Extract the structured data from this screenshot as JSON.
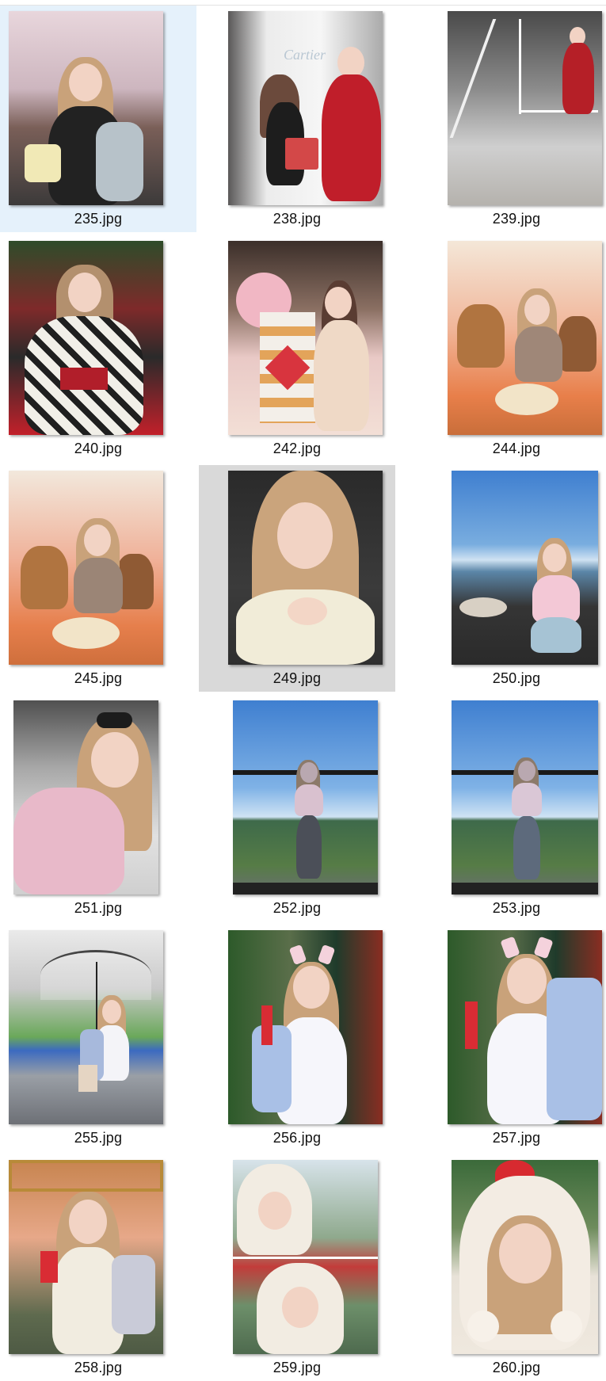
{
  "files": [
    {
      "name": "235.jpg",
      "state": "selected"
    },
    {
      "name": "238.jpg",
      "state": "normal"
    },
    {
      "name": "239.jpg",
      "state": "normal"
    },
    {
      "name": "240.jpg",
      "state": "normal"
    },
    {
      "name": "242.jpg",
      "state": "normal"
    },
    {
      "name": "244.jpg",
      "state": "normal"
    },
    {
      "name": "245.jpg",
      "state": "normal"
    },
    {
      "name": "249.jpg",
      "state": "hover"
    },
    {
      "name": "250.jpg",
      "state": "normal"
    },
    {
      "name": "251.jpg",
      "state": "normal"
    },
    {
      "name": "252.jpg",
      "state": "normal"
    },
    {
      "name": "253.jpg",
      "state": "normal"
    },
    {
      "name": "255.jpg",
      "state": "normal"
    },
    {
      "name": "256.jpg",
      "state": "normal"
    },
    {
      "name": "257.jpg",
      "state": "normal"
    },
    {
      "name": "258.jpg",
      "state": "normal"
    },
    {
      "name": "259.jpg",
      "state": "normal"
    },
    {
      "name": "260.jpg",
      "state": "normal"
    }
  ],
  "colors": {
    "selected_background": "#e5f1fb",
    "hover_background": "#d9d9d9",
    "caption_text": "#111111"
  }
}
